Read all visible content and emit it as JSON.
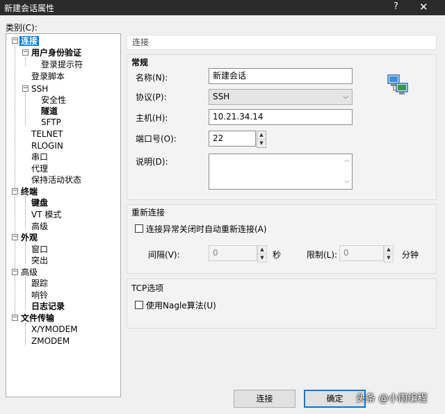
{
  "window": {
    "title": "新建会话属性",
    "help": "?",
    "close": "✕"
  },
  "category_label": "类别(C):",
  "tree": {
    "connection": "连接",
    "user_auth": "用户身份验证",
    "login_prompt": "登录提示符",
    "login_script": "登录脚本",
    "ssh": "SSH",
    "security": "安全性",
    "tunnel": "隧道",
    "sftp": "SFTP",
    "telnet": "TELNET",
    "rlogin": "RLOGIN",
    "serial": "串口",
    "proxy": "代理",
    "keepalive": "保持活动状态",
    "terminal": "终端",
    "keyboard": "键盘",
    "vt_mode": "VT 模式",
    "advanced_term": "高级",
    "appearance": "外观",
    "window": "窗口",
    "highlight": "突出",
    "advanced": "高级",
    "trace": "跟踪",
    "bell": "响铃",
    "logging": "日志记录",
    "file_transfer": "文件传输",
    "xymodem": "X/YMODEM",
    "zmodem": "ZMODEM"
  },
  "section_title": "连接",
  "general": {
    "group": "常规",
    "name_label": "名称(N):",
    "name_value": "新建会话",
    "protocol_label": "协议(P):",
    "protocol_value": "SSH",
    "host_label": "主机(H):",
    "host_value": "10.21.34.14",
    "port_label": "端口号(O):",
    "port_value": "22",
    "desc_label": "说明(D):",
    "desc_value": ""
  },
  "reconnect": {
    "group": "重新连接",
    "auto_label": "连接异常关闭时自动重新连接(A)",
    "interval_label": "间隔(V):",
    "interval_value": "0",
    "seconds": "秒",
    "limit_label": "限制(L):",
    "limit_value": "0",
    "minutes": "分钟"
  },
  "tcp": {
    "group": "TCP选项",
    "nagle_label": "使用Nagle算法(U)"
  },
  "buttons": {
    "connect": "连接",
    "ok": "确定"
  },
  "watermark": "头条 @小雨编程",
  "colors": {
    "titlebar": "#2b2b2b",
    "selection": "#0078d7"
  }
}
